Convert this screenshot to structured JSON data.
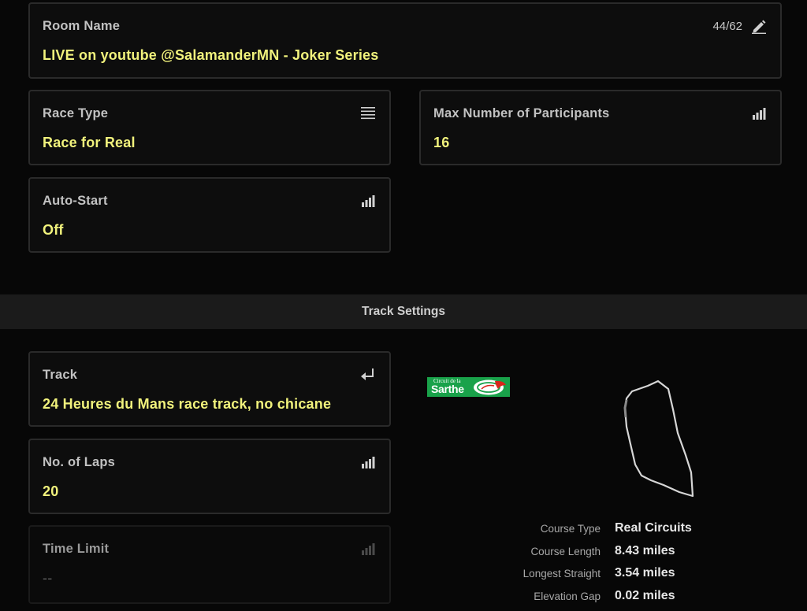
{
  "room_name": {
    "label": "Room Name",
    "value": "LIVE on youtube @SalamanderMN - Joker Series",
    "char_count": "44/62",
    "icon": "pencil-icon"
  },
  "race_type": {
    "label": "Race Type",
    "value": "Race for Real",
    "icon": "list-icon"
  },
  "max_participants": {
    "label": "Max Number of Participants",
    "value": "16",
    "icon": "signal-bars-icon"
  },
  "auto_start": {
    "label": "Auto-Start",
    "value": "Off",
    "icon": "signal-bars-icon"
  },
  "track_settings": {
    "title": "Track Settings"
  },
  "track": {
    "label": "Track",
    "value": "24 Heures du Mans race track, no chicane",
    "icon": "enter-arrow-icon"
  },
  "laps": {
    "label": "No. of Laps",
    "value": "20",
    "icon": "signal-bars-icon"
  },
  "time_limit": {
    "label": "Time Limit",
    "value": "--",
    "icon": "signal-bars-icon"
  },
  "track_logo": {
    "small_text": "Circuit de la",
    "big_text": "Sarthe"
  },
  "course_stats": [
    {
      "key": "Course Type",
      "value": "Real Circuits"
    },
    {
      "key": "Course Length",
      "value": "8.43 miles"
    },
    {
      "key": "Longest Straight",
      "value": "3.54 miles"
    },
    {
      "key": "Elevation Gap",
      "value": "0.02 miles"
    }
  ],
  "colors": {
    "value_yellow": "#f1f27c",
    "background": "#070707",
    "card_border": "#2a2a2a",
    "logo_green": "#19a24a"
  }
}
